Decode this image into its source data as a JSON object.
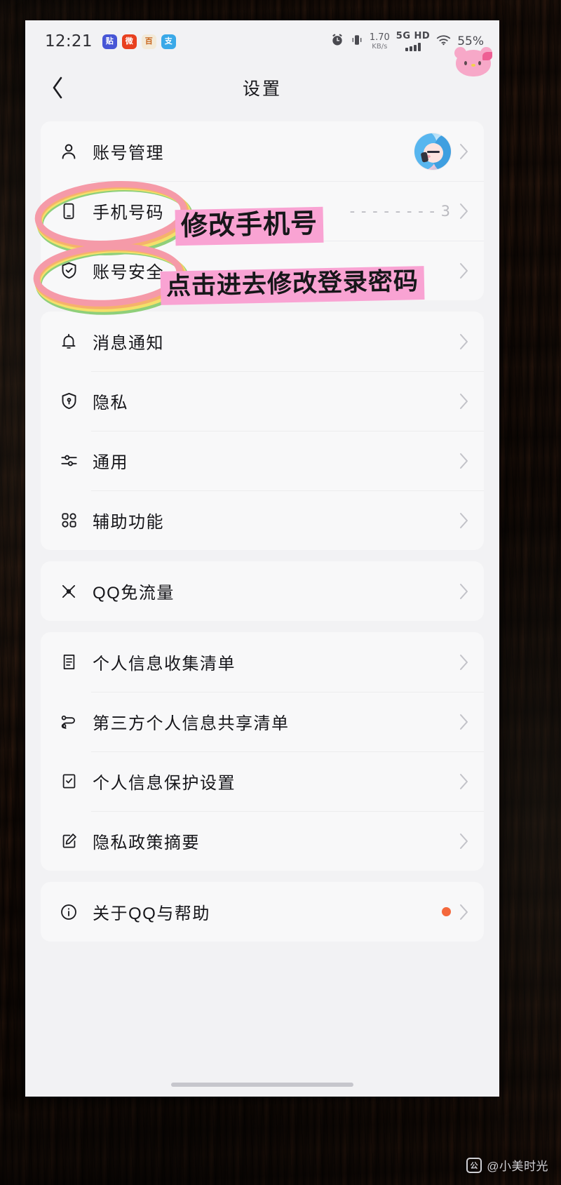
{
  "status_bar": {
    "time": "12:21",
    "app_icons": [
      {
        "name": "tieba-icon",
        "glyph": "贴"
      },
      {
        "name": "weibo-icon",
        "glyph": "微"
      },
      {
        "name": "baidu-icon",
        "glyph": "百"
      },
      {
        "name": "alipay-icon",
        "glyph": "支"
      }
    ],
    "alarm_icon": "alarm-icon",
    "vibrate_icon": "vibrate-icon",
    "net_speed_value": "1.70",
    "net_speed_unit": "KB/s",
    "network_type": "5G HD",
    "wifi_icon": "wifi-icon",
    "battery": "55%",
    "sticker": "hello-kitty-sticker"
  },
  "nav": {
    "back_icon": "chevron-left-icon",
    "title": "设置"
  },
  "sections": [
    {
      "name": "account-section",
      "rows": [
        {
          "icon": "person-icon",
          "label": "账号管理",
          "value": "",
          "avatar": true,
          "badge": false
        },
        {
          "icon": "phone-icon",
          "label": "手机号码",
          "value": "- - - - - - - - 3",
          "avatar": false,
          "badge": false
        },
        {
          "icon": "shield-check-icon",
          "label": "账号安全",
          "value": "",
          "avatar": false,
          "badge": false
        }
      ]
    },
    {
      "name": "preferences-section",
      "rows": [
        {
          "icon": "bell-icon",
          "label": "消息通知",
          "value": "",
          "avatar": false,
          "badge": false
        },
        {
          "icon": "shield-lock-icon",
          "label": "隐私",
          "value": "",
          "avatar": false,
          "badge": false
        },
        {
          "icon": "sliders-icon",
          "label": "通用",
          "value": "",
          "avatar": false,
          "badge": false
        },
        {
          "icon": "grid-icon",
          "label": "辅助功能",
          "value": "",
          "avatar": false,
          "badge": false
        }
      ]
    },
    {
      "name": "data-section",
      "rows": [
        {
          "icon": "signal-waves-icon",
          "label": "QQ免流量",
          "value": "",
          "avatar": false,
          "badge": false
        }
      ]
    },
    {
      "name": "privacy-docs-section",
      "rows": [
        {
          "icon": "document-icon",
          "label": "个人信息收集清单",
          "value": "",
          "avatar": false,
          "badge": false
        },
        {
          "icon": "share-nodes-icon",
          "label": "第三方个人信息共享清单",
          "value": "",
          "avatar": false,
          "badge": false
        },
        {
          "icon": "checkbox-doc-icon",
          "label": "个人信息保护设置",
          "value": "",
          "avatar": false,
          "badge": false
        },
        {
          "icon": "edit-square-icon",
          "label": "隐私政策摘要",
          "value": "",
          "avatar": false,
          "badge": false
        }
      ]
    },
    {
      "name": "about-section",
      "rows": [
        {
          "icon": "info-circle-icon",
          "label": "关于QQ与帮助",
          "value": "",
          "avatar": false,
          "badge": true
        }
      ]
    }
  ],
  "annotations": {
    "phone_note": "修改手机号",
    "password_note": "点击进去修改登录密码",
    "highlight_color": "#f9a3d3",
    "circle_colors": [
      "#f59aa8",
      "#f6b26b",
      "#f4e06a",
      "#8fcf7a"
    ]
  },
  "watermark": {
    "logo_glyph": "公",
    "text": "@小美时光"
  }
}
